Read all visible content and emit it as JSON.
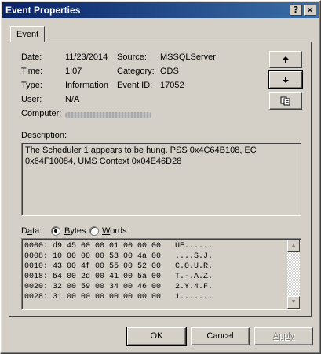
{
  "window": {
    "title": "Event Properties",
    "help_glyph": "?",
    "close_glyph": "×"
  },
  "tab": {
    "label": "Event"
  },
  "fields": {
    "date_label": "Date:",
    "date_value": "11/23/2014",
    "source_label": "Source:",
    "source_value": "MSSQLServer",
    "time_label": "Time:",
    "time_value": "1:07",
    "category_label": "Category:",
    "category_value": "ODS",
    "type_label": "Type:",
    "type_value": "Information",
    "eventid_label": "Event ID:",
    "eventid_value": "17052",
    "user_label": "User:",
    "user_value": "N/A",
    "computer_label": "Computer:"
  },
  "description": {
    "label": "Description:",
    "text": "The Scheduler 1 appears to be hung. PSS 0x4C64B108, EC 0x64F10084, UMS Context 0x04E46D28"
  },
  "data": {
    "label": "Data:",
    "bytes_label": "Bytes",
    "words_label": "Words",
    "selected": "Bytes",
    "rows": [
      "0000: d9 45 00 00 01 00 00 00   ÙE......",
      "0008: 10 00 00 00 53 00 4a 00   ....S.J.",
      "0010: 43 00 4f 00 55 00 52 00   C.O.U.R.",
      "0018: 54 00 2d 00 41 00 5a 00   T.-.A.Z.",
      "0020: 32 00 59 00 34 00 46 00   2.Y.4.F.",
      "0028: 31 00 00 00 00 00 00 00   1......."
    ]
  },
  "buttons": {
    "ok": "OK",
    "cancel": "Cancel",
    "apply": "Apply"
  },
  "icons": {
    "nav_up": "arrow-up-icon",
    "nav_down": "arrow-down-icon",
    "copy": "copy-icon"
  },
  "colors": {
    "title_start": "#0a246a",
    "title_end": "#3a6ea5",
    "face": "#d4d0c8"
  }
}
